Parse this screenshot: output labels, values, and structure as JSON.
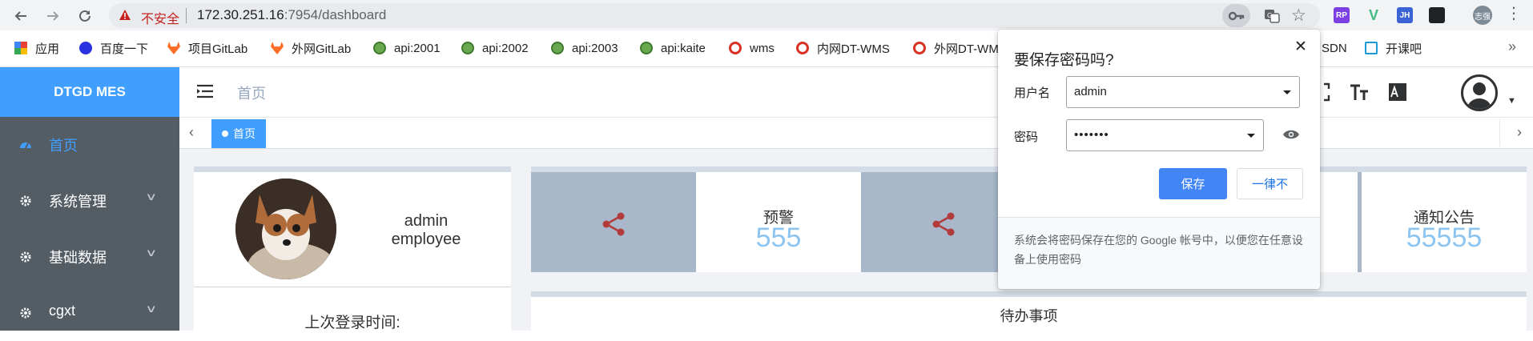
{
  "browser": {
    "security_label": "不安全",
    "url_host": "172.30.251.16",
    "url_path": ":7954/dashboard",
    "extensions": [
      "RP",
      "V",
      "JH",
      "tab-icon"
    ],
    "profile_initials": "志强"
  },
  "bookmarks": [
    {
      "label": "应用",
      "icon": "apps-grid-icon"
    },
    {
      "label": "百度一下",
      "icon": "baidu-icon"
    },
    {
      "label": "项目GitLab",
      "icon": "gitlab-icon"
    },
    {
      "label": "外网GitLab",
      "icon": "gitlab-icon"
    },
    {
      "label": "api:2001",
      "icon": "api-icon"
    },
    {
      "label": "api:2002",
      "icon": "api-icon"
    },
    {
      "label": "api:2003",
      "icon": "api-icon"
    },
    {
      "label": "api:kaite",
      "icon": "api-icon"
    },
    {
      "label": "wms",
      "icon": "wms-icon"
    },
    {
      "label": "内网DT-WMS",
      "icon": "wms-icon"
    },
    {
      "label": "外网DT-WM",
      "icon": "wms-icon"
    },
    {
      "label": "SDN",
      "icon": "csdn-icon"
    },
    {
      "label": "开课吧",
      "icon": "kaikeba-icon"
    }
  ],
  "sidebar": {
    "logo": "DTGD MES",
    "items": [
      {
        "label": "首页",
        "icon": "dashboard-icon",
        "active": true
      },
      {
        "label": "系统管理",
        "icon": "gear-icon",
        "active": false
      },
      {
        "label": "基础数据",
        "icon": "gear-icon",
        "active": false
      },
      {
        "label": "cgxt",
        "icon": "gear-icon",
        "active": false
      }
    ]
  },
  "header": {
    "breadcrumb": "首页"
  },
  "tags": {
    "home_label": "首页"
  },
  "profile": {
    "name": "admin",
    "role": "employee",
    "last_login_label": "上次登录时间:"
  },
  "stats": [
    {
      "title": "",
      "value": "",
      "icon": "share-icon"
    },
    {
      "title": "预警",
      "value": "555",
      "icon": "share-icon"
    },
    {
      "title": "通知公告",
      "value": "55555"
    }
  ],
  "todo": {
    "title": "待办事项"
  },
  "password_popup": {
    "title": "要保存密码吗?",
    "username_label": "用户名",
    "username_value": "admin",
    "password_label": "密码",
    "password_value": "•••••••",
    "save_label": "保存",
    "never_label": "一律不",
    "footer_text": "系统会将密码保存在您的 Google 帐号中，以便您在任意设备上使用密码"
  },
  "colors": {
    "accent": "#409eff",
    "sidebar_bg": "#545c64",
    "stat_icon_bg": "#a8b8ca",
    "stat_number": "#8dc5f2",
    "share_icon": "#b23a3a",
    "chrome_save_button": "#4285f4"
  }
}
